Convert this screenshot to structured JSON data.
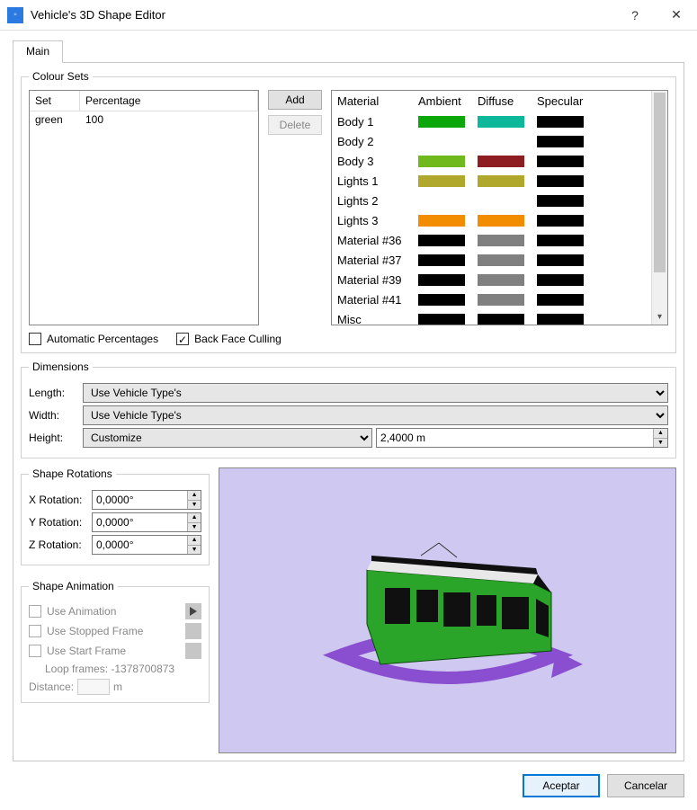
{
  "window": {
    "title": "Vehicle's 3D Shape Editor",
    "help": "?",
    "close": "✕"
  },
  "tabs": {
    "main": "Main"
  },
  "colour_sets": {
    "legend": "Colour Sets",
    "headers": {
      "set": "Set",
      "percentage": "Percentage"
    },
    "rows": [
      {
        "set": "green",
        "percentage": "100"
      }
    ],
    "buttons": {
      "add": "Add",
      "delete": "Delete"
    },
    "materials": {
      "headers": {
        "material": "Material",
        "ambient": "Ambient",
        "diffuse": "Diffuse",
        "specular": "Specular"
      },
      "rows": [
        {
          "name": "Body 1",
          "ambient": "#0aa60a",
          "diffuse": "#0cb79a",
          "specular": "#000000"
        },
        {
          "name": "Body 2",
          "ambient": "",
          "diffuse": "",
          "specular": "#000000"
        },
        {
          "name": "Body 3",
          "ambient": "#6fb91c",
          "diffuse": "#8e1d22",
          "specular": "#000000"
        },
        {
          "name": "Lights 1",
          "ambient": "#b0a82d",
          "diffuse": "#b0a82d",
          "specular": "#000000"
        },
        {
          "name": "Lights 2",
          "ambient": "",
          "diffuse": "",
          "specular": "#000000"
        },
        {
          "name": "Lights 3",
          "ambient": "#f28c00",
          "diffuse": "#f28c00",
          "specular": "#000000"
        },
        {
          "name": "Material #36",
          "ambient": "#000000",
          "diffuse": "#808080",
          "specular": "#000000"
        },
        {
          "name": "Material #37",
          "ambient": "#000000",
          "diffuse": "#808080",
          "specular": "#000000"
        },
        {
          "name": "Material #39",
          "ambient": "#000000",
          "diffuse": "#808080",
          "specular": "#000000"
        },
        {
          "name": "Material #41",
          "ambient": "#000000",
          "diffuse": "#808080",
          "specular": "#000000"
        },
        {
          "name": "Misc",
          "ambient": "#000000",
          "diffuse": "#000000",
          "specular": "#000000"
        }
      ]
    },
    "checks": {
      "auto_percent": "Automatic Percentages",
      "back_face": "Back Face Culling"
    }
  },
  "dimensions": {
    "legend": "Dimensions",
    "length_label": "Length:",
    "width_label": "Width:",
    "height_label": "Height:",
    "length_value": "Use Vehicle Type's",
    "width_value": "Use Vehicle Type's",
    "height_mode": "Customize",
    "height_value": "2,4000 m"
  },
  "rotations": {
    "legend": "Shape Rotations",
    "x_label": "X Rotation:",
    "y_label": "Y Rotation:",
    "z_label": "Z Rotation:",
    "x_value": "0,0000°",
    "y_value": "0,0000°",
    "z_value": "0,0000°"
  },
  "animation": {
    "legend": "Shape Animation",
    "use_animation": "Use Animation",
    "use_stopped": "Use Stopped Frame",
    "use_start": "Use Start Frame",
    "loop_info": "Loop frames: -1378700873",
    "distance_label": "Distance:",
    "distance_unit": "m"
  },
  "footer": {
    "ok": "Aceptar",
    "cancel": "Cancelar"
  }
}
